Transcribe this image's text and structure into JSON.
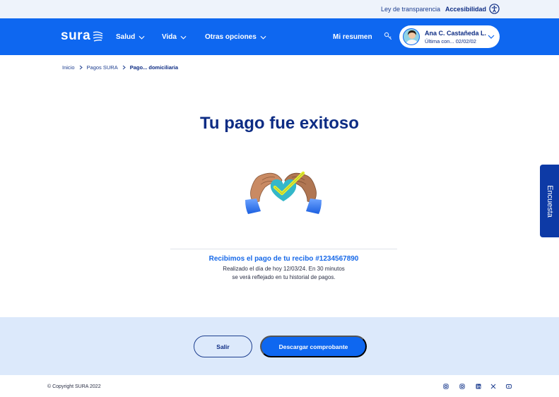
{
  "topbar": {
    "transparency_link": "Ley de transparencia",
    "accessibility_link": "Accesibilidad",
    "accessibility_icon": "accessibility-icon"
  },
  "nav": {
    "logo": "sura",
    "items": [
      {
        "label": "Salud"
      },
      {
        "label": "Vida"
      },
      {
        "label": "Otras opciones"
      }
    ],
    "resumen": "Mi resumen",
    "key_icon": "key-icon",
    "user": {
      "name": "Ana C. Castañeda L.",
      "last_connection": "Última con... 02/02/02"
    }
  },
  "breadcrumb": {
    "items": [
      "Inicio",
      "Pagos SURA",
      "Pago... domiciliaria"
    ]
  },
  "main": {
    "title": "Tu pago fue exitoso",
    "illustration": "heart-hands-check-icon",
    "receipt_message": "Recibimos el pago de tu recibo #1234567890",
    "detail_line1": "Realizado el día de hoy 12/03/24. En 30 minutos",
    "detail_line2": "se verá reflejado en tu historial de pagos."
  },
  "survey_tab": "Encuesta",
  "actions": {
    "exit_label": "Salir",
    "download_label": "Descargar comprobante"
  },
  "footer": {
    "copyright": "© Copyright SURA 2022",
    "social_icons": [
      "instagram-icon",
      "instagram-icon",
      "linkedin-icon",
      "x-icon",
      "youtube-icon"
    ]
  },
  "colors": {
    "primary": "#0e67f0",
    "navy": "#0d2c84",
    "light_bg": "#dce9fb"
  }
}
